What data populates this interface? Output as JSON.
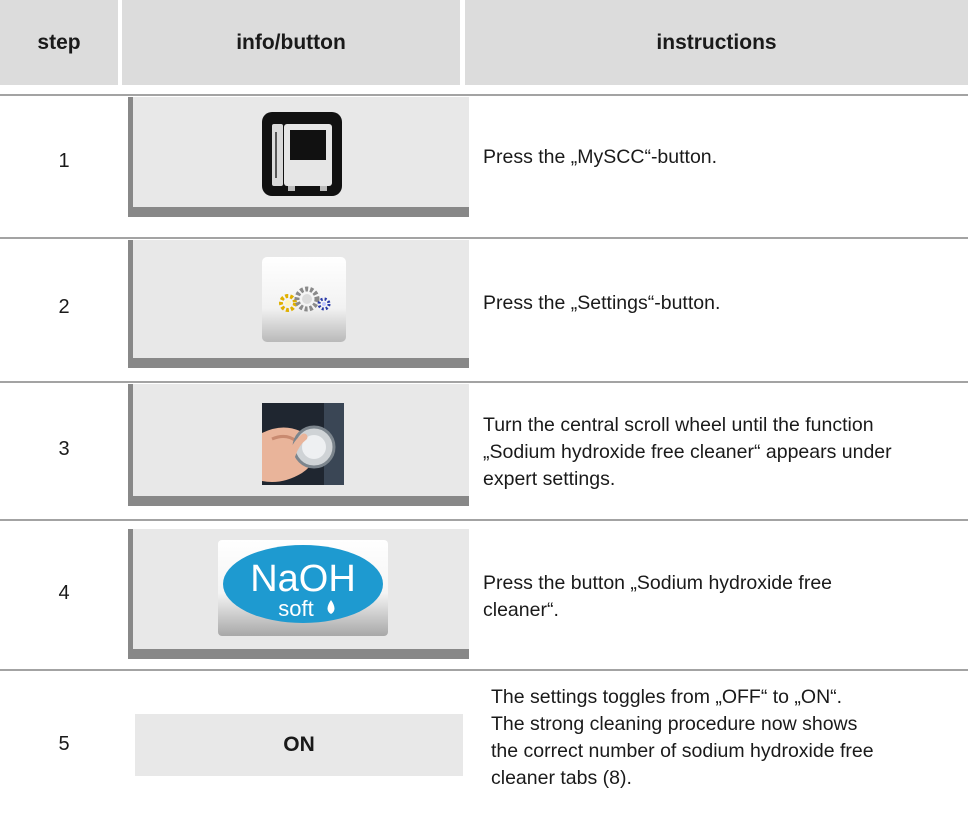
{
  "header": {
    "step": "step",
    "info": "info/button",
    "instructions": "instructions"
  },
  "rows": [
    {
      "step": "1",
      "icon": "myscc-icon",
      "instruction": "Press the „MySCC“-button."
    },
    {
      "step": "2",
      "icon": "settings-gears-icon",
      "instruction": "Press the „Settings“-button."
    },
    {
      "step": "3",
      "icon": "scroll-wheel-icon",
      "instruction_lines": [
        "Turn the central scroll wheel until the function",
        "„Sodium hydroxide free cleaner“ appears under",
        "expert settings."
      ]
    },
    {
      "step": "4",
      "icon": "naoh-soft-icon",
      "icon_text_main": "NaOH",
      "icon_text_sub": "soft",
      "instruction_lines": [
        "Press the button „Sodium hydroxide free",
        "cleaner“."
      ]
    },
    {
      "step": "5",
      "button_label": "ON",
      "instruction_lines": [
        "The settings toggles from „OFF“ to „ON“.",
        "The strong cleaning procedure now shows",
        "the correct number of sodium hydroxide free",
        "cleaner tabs (8)."
      ]
    }
  ],
  "colors": {
    "header_bg": "#dcdcdc",
    "cell_bg": "#e8e8e8",
    "separator": "#a3a3a3",
    "naoh_blue": "#1e9ad0"
  }
}
